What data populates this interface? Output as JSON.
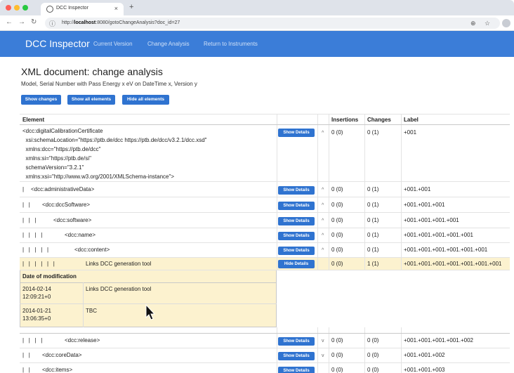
{
  "browser": {
    "tab_title": "DCC Inspector",
    "tab_close": "×",
    "new_tab": "+",
    "url_prefix": "http://",
    "url_host": "localhost",
    "url_rest": ":8080/gotoChangeAnalysis?doc_id=27"
  },
  "nav": {
    "brand": "DCC Inspector",
    "links": [
      "Current Version",
      "Change Analysis",
      "Return to Instruments"
    ]
  },
  "page": {
    "title": "XML document: change analysis",
    "subtitle": "Model, Serial Number with Pass Energy x eV on DateTime x, Version y",
    "buttons": [
      "Show changes",
      "Show all elements",
      "Hide all elements"
    ]
  },
  "table": {
    "headers": [
      "Element",
      "Insertions",
      "Changes",
      "Label"
    ],
    "root_lines": [
      "<dcc:digitalCalibrationCertificate",
      "  xsi:schemaLocation=\"https://ptb.de/dcc https://ptb.de/dcc/v3.2.1/dcc.xsd\"",
      "  xmlns:dcc=\"https://ptb.de/dcc\"",
      "  xmlns:si=\"https://ptb.de/si\"",
      "  schemaVersion=\"3.2.1\"",
      "  xmlns:xsi=\"http://www.w3.org/2001/XMLSchema-instance\">"
    ],
    "rows": [
      {
        "prefix": "",
        "element": "",
        "button": "Show Details",
        "caret": "^",
        "insertions": "0 (0)",
        "changes": "0 (1)",
        "label": "+001"
      },
      {
        "prefix": "|",
        "element": "<dcc:administrativeData>",
        "button": "Show Details",
        "caret": "^",
        "insertions": "0 (0)",
        "changes": "0 (1)",
        "label": "+001.+001"
      },
      {
        "prefix": "|   |",
        "element": "<dcc:dccSoftware>",
        "button": "Show Details",
        "caret": "^",
        "insertions": "0 (0)",
        "changes": "0 (1)",
        "label": "+001.+001.+001"
      },
      {
        "prefix": "|   |   |",
        "element": "<dcc:software>",
        "button": "Show Details",
        "caret": "^",
        "insertions": "0 (0)",
        "changes": "0 (1)",
        "label": "+001.+001.+001.+001"
      },
      {
        "prefix": "|   |   |   |",
        "element": "<dcc:name>",
        "button": "Show Details",
        "caret": "^",
        "insertions": "0 (0)",
        "changes": "0 (1)",
        "label": "+001.+001.+001.+001.+001"
      },
      {
        "prefix": "|   |   |   |   |",
        "element": "<dcc:content>",
        "button": "Show Details",
        "caret": "^",
        "insertions": "0 (0)",
        "changes": "0 (1)",
        "label": "+001.+001.+001.+001.+001.+001"
      },
      {
        "prefix": "|   |   |   |   |   |",
        "element": "Links DCC generation tool",
        "button": "Hide Details",
        "caret": "",
        "insertions": "0 (0)",
        "changes": "1 (1)",
        "label": "+001.+001.+001.+001.+001.+001.+001"
      },
      {
        "prefix": "|   |   |   |",
        "element": "<dcc:release>",
        "button": "Show Details",
        "caret": "v",
        "insertions": "0 (0)",
        "changes": "0 (0)",
        "label": "+001.+001.+001.+001.+002"
      },
      {
        "prefix": "|   |",
        "element": "<dcc:coreData>",
        "button": "Show Details",
        "caret": "v",
        "insertions": "0 (0)",
        "changes": "0 (0)",
        "label": "+001.+001.+002"
      },
      {
        "prefix": "|   |",
        "element": "<dcc:items>",
        "button": "Show Details",
        "caret": "",
        "insertions": "0 (0)",
        "changes": "0 (0)",
        "label": "+001.+001.+003"
      }
    ],
    "detail": {
      "header": "Date of modification",
      "entries": [
        {
          "date": "2014-02-14",
          "time": "12:09:21+0",
          "value": "Links DCC generation tool"
        },
        {
          "date": "2014-01-21",
          "time": "13:06:35+0",
          "value": "TBC"
        }
      ]
    }
  },
  "colors": {
    "accent": "#3b7dd8",
    "button": "#2f73d0",
    "highlight": "#fcf2cf"
  }
}
